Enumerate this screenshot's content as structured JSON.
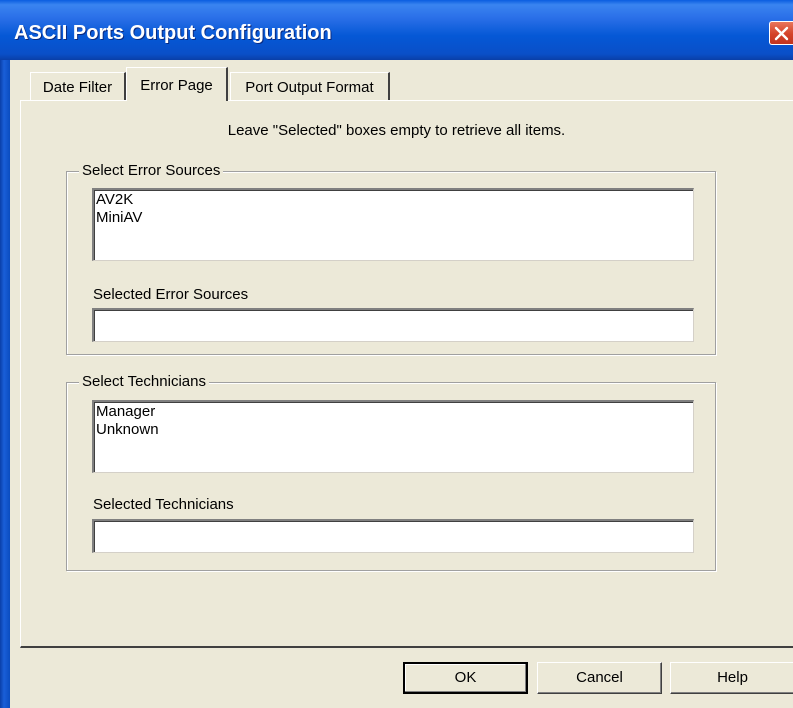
{
  "window": {
    "title": "ASCII Ports Output Configuration"
  },
  "tabs": [
    {
      "label": "Date Filter",
      "selected": false
    },
    {
      "label": "Error Page",
      "selected": true
    },
    {
      "label": "Port Output Format",
      "selected": false
    }
  ],
  "error_page": {
    "hint": "Leave \"Selected\" boxes empty to retrieve all items.",
    "error_sources": {
      "group_label": "Select Error Sources",
      "items": [
        "AV2K",
        "MiniAV"
      ],
      "selected_label": "Selected Error Sources",
      "selected_value": ""
    },
    "technicians": {
      "group_label": "Select Technicians",
      "items": [
        "Manager",
        "Unknown"
      ],
      "selected_label": "Selected Technicians",
      "selected_value": ""
    }
  },
  "buttons": {
    "ok": "OK",
    "cancel": "Cancel",
    "help": "Help"
  },
  "colors": {
    "dialog_bg": "#ece9d8",
    "titlebar": "#0558d6",
    "close_button": "#d4432a"
  }
}
